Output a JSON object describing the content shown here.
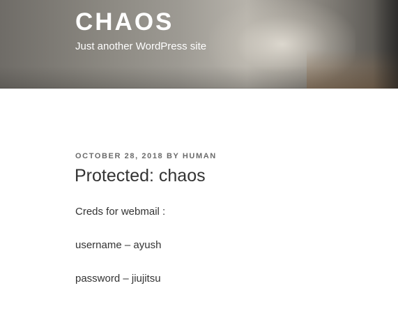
{
  "header": {
    "site_title": "CHAOS",
    "site_description": "Just another WordPress site"
  },
  "post": {
    "date": "OCTOBER 28, 2018",
    "by_label": "BY",
    "author": "HUMAN",
    "title": "Protected: chaos",
    "paragraphs": [
      "Creds for webmail :",
      "username – ayush",
      "password – jiujitsu"
    ]
  },
  "colors": {
    "header_text": "#ffffff",
    "meta_text": "#6b6b6b",
    "body_text": "#333333"
  }
}
